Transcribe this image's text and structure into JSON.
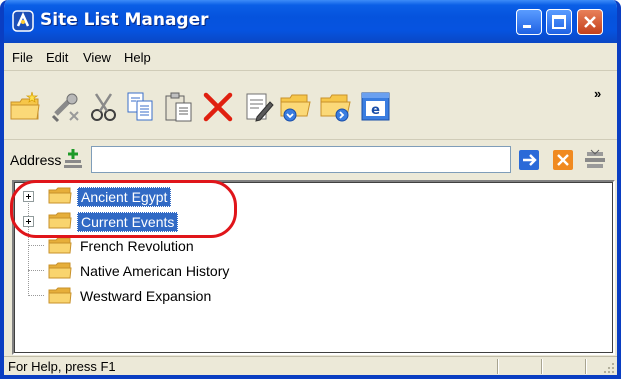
{
  "window": {
    "title": "Site List Manager"
  },
  "menubar": {
    "items": [
      "File",
      "Edit",
      "View",
      "Help"
    ]
  },
  "toolbar": {
    "tools": [
      "new-folder-icon",
      "properties-icon",
      "cut-icon",
      "copy-icon",
      "paste-icon",
      "delete-icon",
      "edit-icon",
      "import-icon",
      "export-icon",
      "browser-icon"
    ],
    "overflow": "»"
  },
  "addressbar": {
    "label": "Address",
    "value": ""
  },
  "tree": {
    "items": [
      {
        "label": "Ancient Egypt",
        "expandable": true,
        "selected": true
      },
      {
        "label": "Current Events",
        "expandable": true,
        "selected": true
      },
      {
        "label": "French Revolution",
        "expandable": false,
        "selected": false
      },
      {
        "label": "Native American History",
        "expandable": false,
        "selected": false
      },
      {
        "label": "Westward Expansion",
        "expandable": false,
        "selected": false
      }
    ]
  },
  "statusbar": {
    "text": "For Help, press F1"
  },
  "colors": {
    "title_blue": "#0553dd",
    "selection": "#316ac5",
    "annotation_red": "#e0151a",
    "folder_yellow": "#f6c649"
  }
}
